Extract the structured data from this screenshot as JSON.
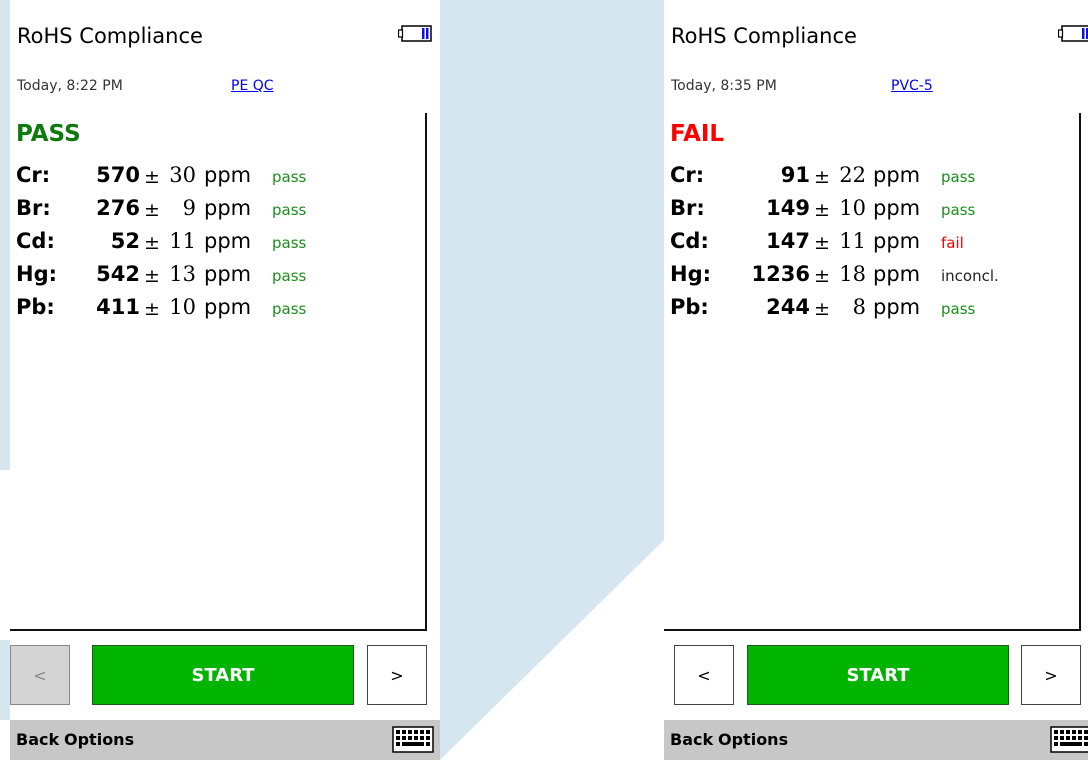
{
  "screens": [
    {
      "title": "RoHS Compliance",
      "datetime": "Today, 8:22 PM",
      "sample": "PE QC",
      "status": "PASS",
      "status_color": "#0e7a0e",
      "rows": [
        {
          "element": "Cr:",
          "value": "570",
          "pm": "±",
          "unc": "30",
          "unit": "ppm",
          "verdict": "pass"
        },
        {
          "element": "Br:",
          "value": "276",
          "pm": "±",
          "unc": "9",
          "unit": "ppm",
          "verdict": "pass"
        },
        {
          "element": "Cd:",
          "value": "52",
          "pm": "±",
          "unc": "11",
          "unit": "ppm",
          "verdict": "pass"
        },
        {
          "element": "Hg:",
          "value": "542",
          "pm": "±",
          "unc": "13",
          "unit": "ppm",
          "verdict": "pass"
        },
        {
          "element": "Pb:",
          "value": "411",
          "pm": "±",
          "unc": "10",
          "unit": "ppm",
          "verdict": "pass"
        }
      ],
      "prev_label": "<",
      "prev_disabled": true,
      "start_label": "START",
      "next_label": ">",
      "softkeys": {
        "back": "Back",
        "options": "Options"
      },
      "icons": {
        "battery": "battery-icon",
        "keyboard": "keyboard-icon"
      }
    },
    {
      "title": "RoHS Compliance",
      "datetime": "Today, 8:35 PM",
      "sample": "PVC-5",
      "status": "FAIL",
      "status_color": "#ff0000",
      "rows": [
        {
          "element": "Cr:",
          "value": "91",
          "pm": "±",
          "unc": "22",
          "unit": "ppm",
          "verdict": "pass"
        },
        {
          "element": "Br:",
          "value": "149",
          "pm": "±",
          "unc": "10",
          "unit": "ppm",
          "verdict": "pass"
        },
        {
          "element": "Cd:",
          "value": "147",
          "pm": "±",
          "unc": "11",
          "unit": "ppm",
          "verdict": "fail"
        },
        {
          "element": "Hg:",
          "value": "1236",
          "pm": "±",
          "unc": "18",
          "unit": "ppm",
          "verdict": "inconcl."
        },
        {
          "element": "Pb:",
          "value": "244",
          "pm": "±",
          "unc": "8",
          "unit": "ppm",
          "verdict": "pass"
        }
      ],
      "prev_label": "<",
      "prev_disabled": false,
      "start_label": "START",
      "next_label": ">",
      "softkeys": {
        "back": "Back",
        "options": "Options"
      },
      "icons": {
        "battery": "battery-icon",
        "keyboard": "keyboard-icon"
      }
    }
  ],
  "colors": {
    "verdict_pass": "#1a8f1a",
    "verdict_fail": "#ff0000",
    "verdict_inconcl": "#222222",
    "start_button": "#00b400",
    "softkey_bar": "#c7c7c7",
    "link": "#0000ee",
    "background_accent": "#d6e6f1"
  }
}
